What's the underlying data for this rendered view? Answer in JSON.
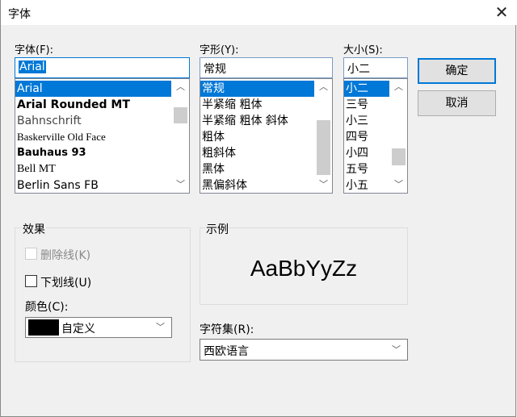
{
  "window": {
    "title": "字体",
    "close_icon": "close-icon"
  },
  "font": {
    "label": "字体(F):",
    "value": "Arial",
    "items": [
      "Arial",
      "Arial Rounded MT",
      "Bahnschrift",
      "Baskerville Old Face",
      "Bauhaus 93",
      "Bell MT",
      "Berlin Sans FB"
    ],
    "selected": 0
  },
  "style": {
    "label": "字形(Y):",
    "value": "常规",
    "items": [
      "常规",
      "半紧缩 粗体",
      "半紧缩 粗体 斜体",
      "粗体",
      "粗斜体",
      "黑体",
      "黑偏斜体"
    ],
    "selected": 0
  },
  "size": {
    "label": "大小(S):",
    "value": "小二",
    "items": [
      "小二",
      "三号",
      "小三",
      "四号",
      "小四",
      "五号",
      "小五"
    ],
    "selected": 0
  },
  "buttons": {
    "ok": "确定",
    "cancel": "取消"
  },
  "effects": {
    "title": "效果",
    "strikeout": "删除线(K)",
    "underline": "下划线(U)",
    "color_label": "颜色(C):",
    "color_value": "自定义",
    "color_swatch": "#000000"
  },
  "sample": {
    "title": "示例",
    "text": "AaBbYyZz"
  },
  "charset": {
    "label": "字符集(R):",
    "value": "西欧语言"
  },
  "colors": {
    "accent": "#0078d7"
  }
}
